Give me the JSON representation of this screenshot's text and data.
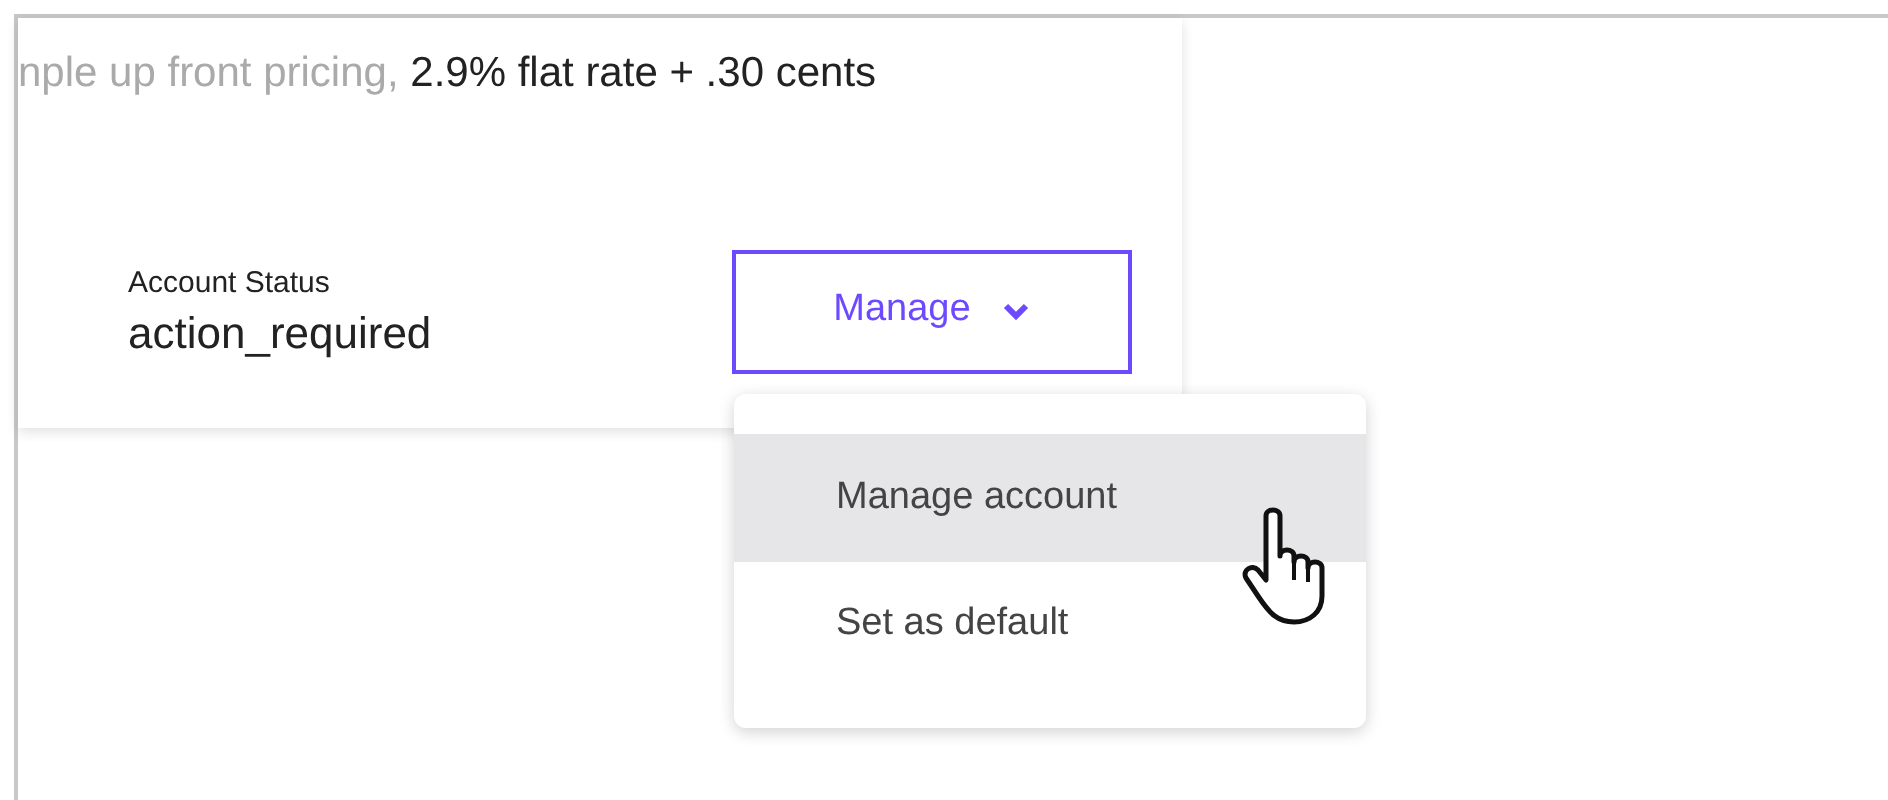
{
  "pricing": {
    "muted": "nple up front pricing,",
    "text": "2.9% flat rate + .30 cents"
  },
  "account_status": {
    "label": "Account Status",
    "value": "action_required"
  },
  "manage_button": {
    "label": "Manage",
    "expanded": true
  },
  "menu": {
    "items": [
      {
        "label": "Manage account",
        "selected": true
      },
      {
        "label": "Set as default",
        "selected": false
      }
    ]
  }
}
